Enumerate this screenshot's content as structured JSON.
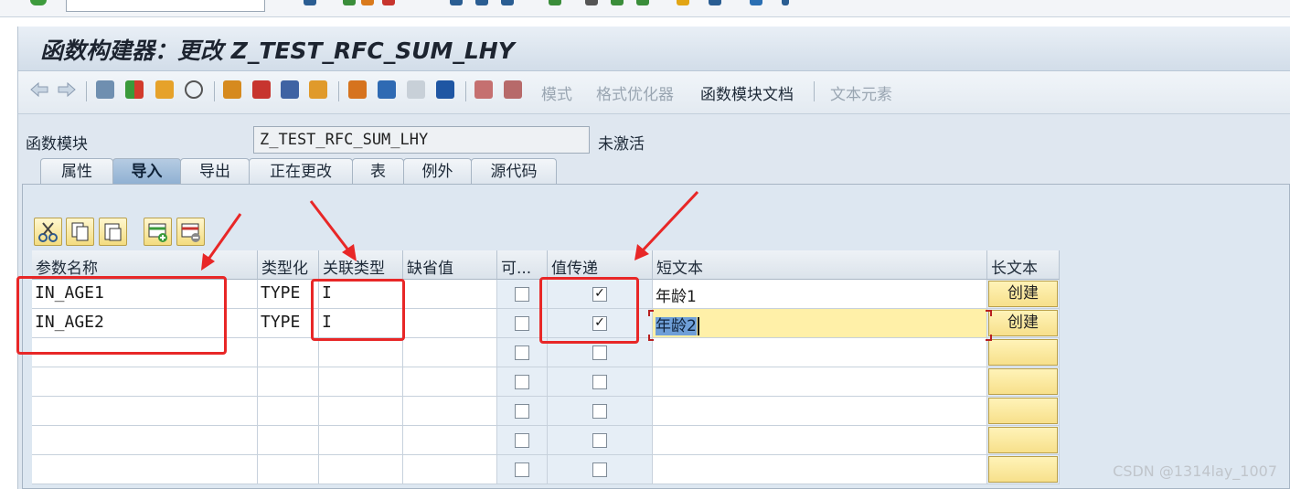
{
  "window": {
    "title": "函数构建器：更改 Z_TEST_RFC_SUM_LHY"
  },
  "toolbar": {
    "mode": "模式",
    "pretty_printer": "格式优化器",
    "fm_doc": "函数模块文档",
    "text_elements": "文本元素"
  },
  "header": {
    "fm_label": "函数模块",
    "fm_value": "Z_TEST_RFC_SUM_LHY",
    "status": "未激活"
  },
  "tabs": [
    "属性",
    "导入",
    "导出",
    "正在更改",
    "表",
    "例外",
    "源代码"
  ],
  "active_tab": "导入",
  "grid": {
    "columns": [
      "参数名称",
      "类型化",
      "关联类型",
      "缺省值",
      "可...",
      "值传递",
      "短文本",
      "长文本"
    ],
    "rows": [
      {
        "name": "IN_AGE1",
        "typing": "TYPE",
        "ref_type": "I",
        "default": "",
        "optional": false,
        "pass_value": true,
        "short_text": "年龄1",
        "long_text": "创建"
      },
      {
        "name": "IN_AGE2",
        "typing": "TYPE",
        "ref_type": "I",
        "default": "",
        "optional": false,
        "pass_value": true,
        "short_text": "年龄2",
        "long_text": "创建"
      }
    ],
    "check_mark": "✓",
    "empty_rows": 5
  },
  "watermark": "CSDN @1314lay_1007",
  "colors": {
    "annotation": "#e82727",
    "selection": "#fff0a8"
  }
}
